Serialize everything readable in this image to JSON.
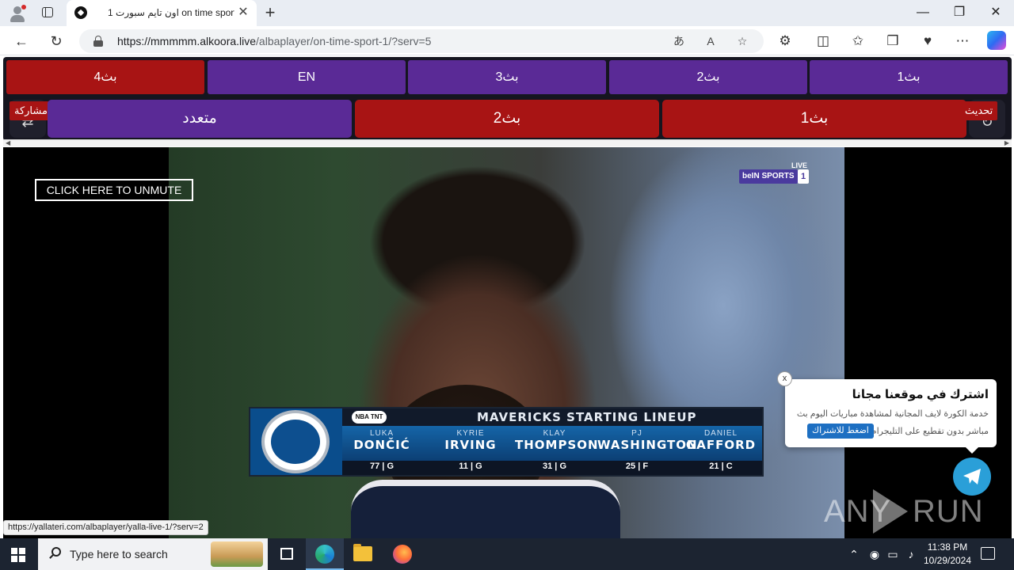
{
  "browser": {
    "tab_title": "اون تايم سبورت 1 on time sport",
    "url_host": "https://mmmmm.alkoora.live",
    "url_path": "/albaplayer/on-time-sport-1/?serv=5",
    "window_controls": [
      "minimize",
      "maximize",
      "close"
    ]
  },
  "page": {
    "server_row1": [
      {
        "label": "بث4",
        "color": "#a81414"
      },
      {
        "label": "EN",
        "color": "#5a2a96"
      },
      {
        "label": "بث3",
        "color": "#5a2a96"
      },
      {
        "label": "بث2",
        "color": "#5a2a96"
      },
      {
        "label": "بث1",
        "color": "#5a2a96"
      }
    ],
    "server_row2": [
      {
        "label": "متعدد",
        "color": "#5a2a96"
      },
      {
        "label": "بث2",
        "color": "#a81414"
      },
      {
        "label": "بث1",
        "color": "#a81414"
      }
    ],
    "share_label": "مشاركة",
    "refresh_label": "تحديث",
    "unmute_label": "CLICK HERE TO UNMUTE",
    "status_link": "https://yallateri.com/albaplayer/yalla-live-1/?serv=2"
  },
  "video": {
    "channel_live": "LIVE",
    "channel_name": "beIN SPORTS",
    "channel_number": "1",
    "lineup_title": "MAVERICKS STARTING LINEUP",
    "broadcaster": "NBA TNT",
    "players": [
      {
        "first": "LUKA",
        "last": "DONČIĆ",
        "number": "77",
        "pos": "G"
      },
      {
        "first": "KYRIE",
        "last": "IRVING",
        "number": "11",
        "pos": "G"
      },
      {
        "first": "KLAY",
        "last": "THOMPSON",
        "number": "31",
        "pos": "G"
      },
      {
        "first": "PJ",
        "last": "WASHINGTON",
        "number": "25",
        "pos": "F"
      },
      {
        "first": "DANIEL",
        "last": "GAFFORD",
        "number": "21",
        "pos": "C"
      }
    ],
    "watermark_left": "ANY",
    "watermark_right": "RUN"
  },
  "popup": {
    "title": "اشترك في موقعنا مجانا",
    "desc_line1": "خدمة الكورة لايف المجانية لمشاهدة مباريات اليوم بث",
    "desc_line2": "مباشر بدون تقطيع على التليجرام",
    "button": "اضغط للاشتراك",
    "close": "x"
  },
  "taskbar": {
    "search_placeholder": "Type here to search",
    "time": "11:38 PM",
    "date": "10/29/2024"
  }
}
